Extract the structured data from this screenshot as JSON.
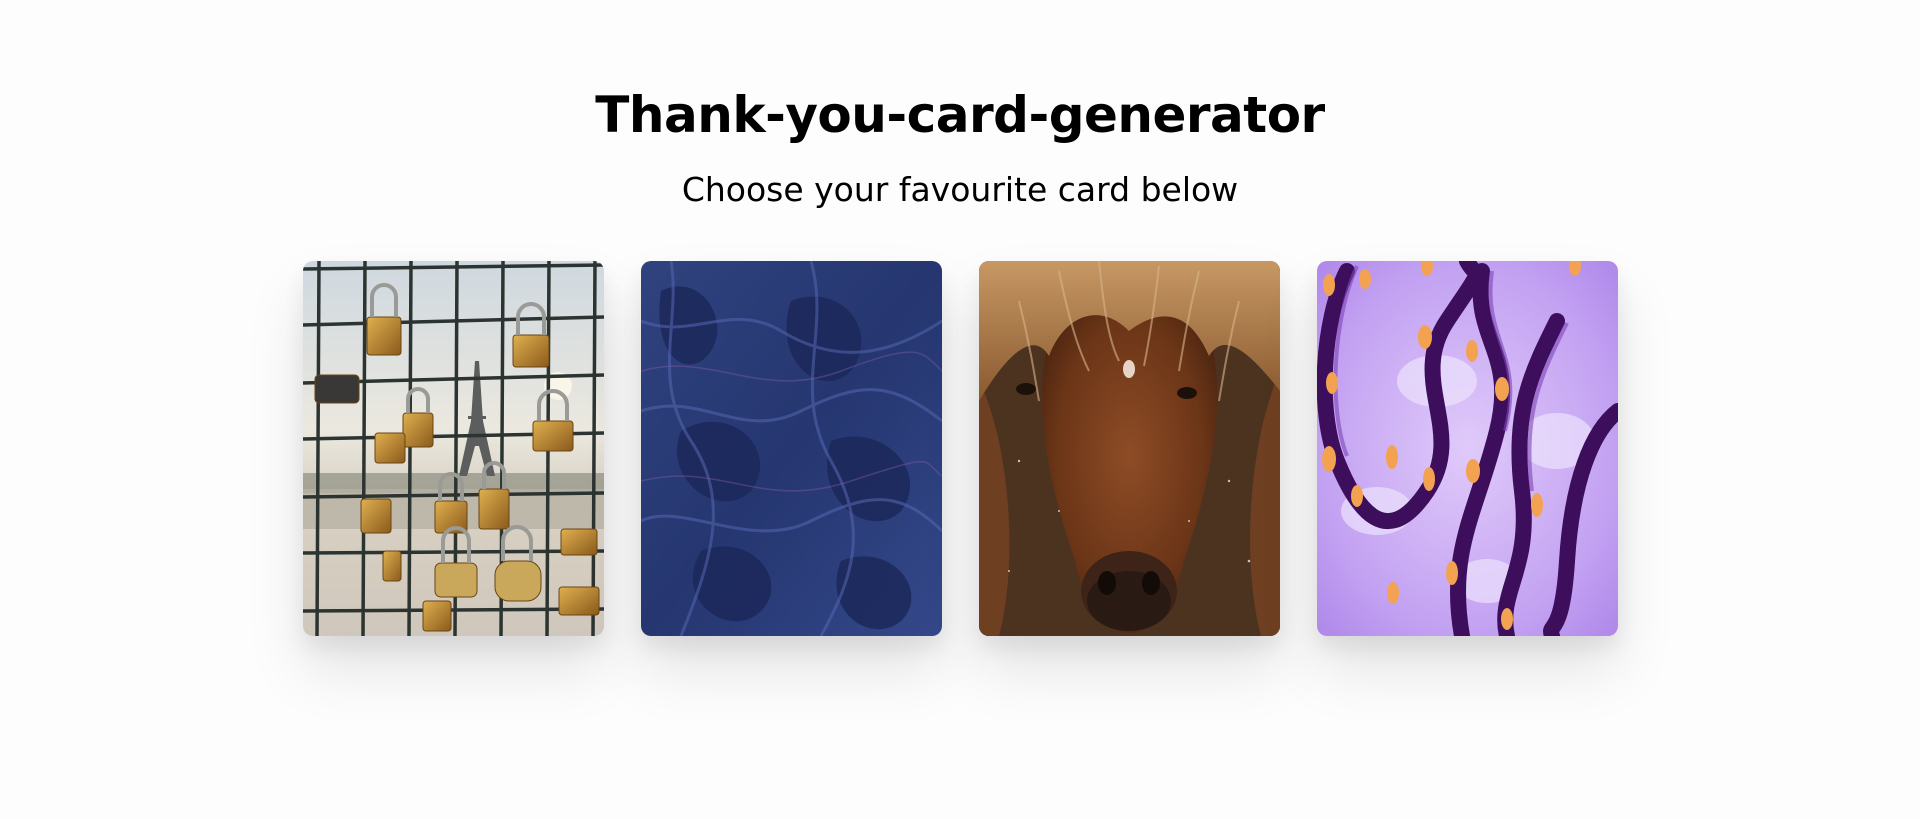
{
  "header": {
    "title": "Thank-you-card-generator",
    "subtitle": "Choose your favourite card below"
  },
  "cards": [
    {
      "image": "padlocks-eiffel-tower-image",
      "colors": {
        "sky": "#e7e5de",
        "lock": "#b8862e",
        "grid": "#2f3a36"
      }
    },
    {
      "image": "blue-liquid-abstract-image",
      "colors": {
        "base": "#2c3e78",
        "dark": "#1d2a5c",
        "light": "#4a5fa8"
      }
    },
    {
      "image": "brown-horse-portrait-image",
      "colors": {
        "base": "#7a4122",
        "mane": "#b07a4a",
        "bg": "#2a2a26"
      }
    },
    {
      "image": "purple-abstract-swirl-image",
      "colors": {
        "base": "#c9a6f5",
        "dark": "#3a0f5a",
        "dot": "#f2a053"
      }
    }
  ]
}
